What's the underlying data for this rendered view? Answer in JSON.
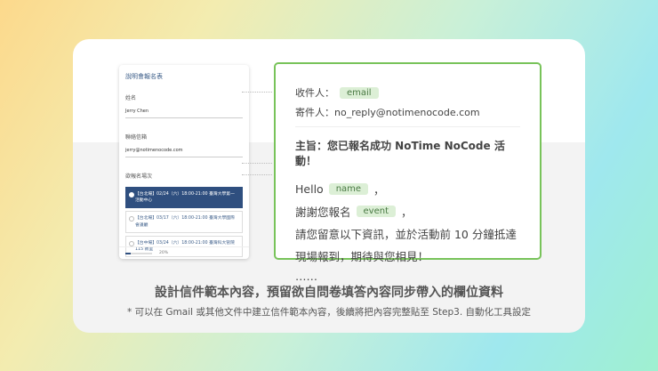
{
  "form": {
    "title": "說明會報名表",
    "name_label": "姓名",
    "name_value": "Jerry Chen",
    "email_label": "聯絡信箱",
    "email_value": "jerry@notimenocode.com",
    "session_label": "欲報名場次",
    "options": [
      {
        "label": "【台北場】02/24（六）18:00-21:00 臺灣大學第一活動中心",
        "selected": true
      },
      {
        "label": "【台北場】03/17（六）18:00-21:00 臺灣大學國際會議廳",
        "selected": false
      },
      {
        "label": "【台中場】03/24（六）18:00-21:00 臺灣科大管院 115 教室",
        "selected": false
      }
    ],
    "progress_percent": 20,
    "progress_label": "20%"
  },
  "mail": {
    "to_label": "收件人：",
    "to_tag": "email",
    "from_label": "寄件人：",
    "from_value": "no_reply@notimenocode.com",
    "subject": "主旨：您已報名成功 NoTime NoCode 活動！",
    "hello": "Hello",
    "name_tag": "name",
    "comma": "，",
    "thanks": "謝謝您報名",
    "event_tag": "event",
    "line3": "請您留意以下資訊，並於活動前 10 分鐘抵達",
    "line4": "現場報到，期待與您相見！",
    "ellipsis": "……"
  },
  "caption": {
    "title": "設計信件範本內容，預留欲自問卷填答內容同步帶入的欄位資料",
    "note": "* 可以在 Gmail 或其他文件中建立信件範本內容，後續將把內容完整貼至 Step3. 自動化工具設定"
  },
  "colors": {
    "accent": "#78c35a",
    "form_primary": "#2f4f7f"
  }
}
